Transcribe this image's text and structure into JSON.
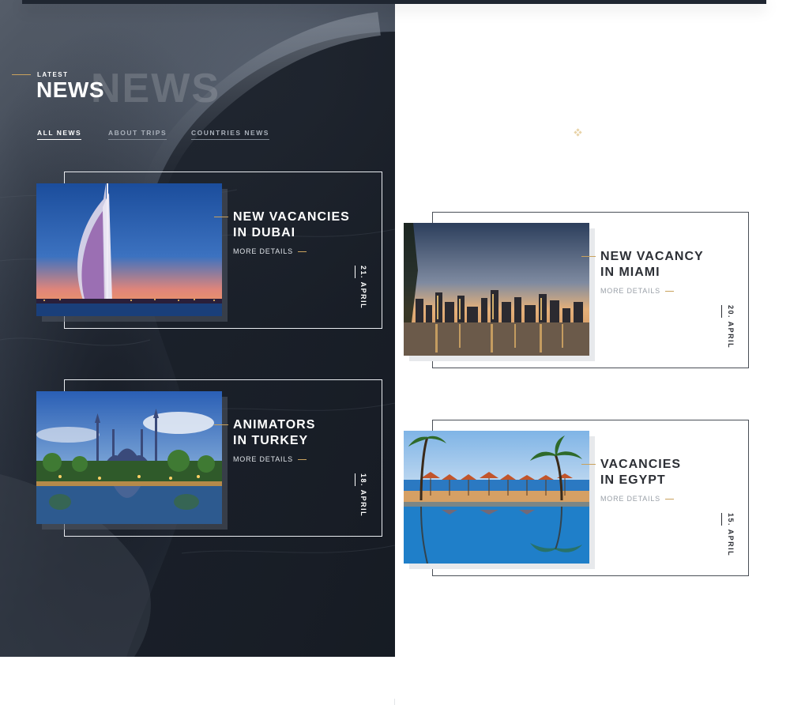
{
  "header": {
    "eyebrow": "LATEST",
    "title": "NEWS",
    "ghost_title": "NEWS"
  },
  "tabs": [
    {
      "label": "ALL NEWS",
      "active": true
    },
    {
      "label": "ABOUT TRIPS",
      "active": false
    },
    {
      "label": "COUNTRIES NEWS",
      "active": false
    }
  ],
  "cards": [
    {
      "line1": "NEW VACANCIES",
      "line2": "IN DUBAI",
      "more": "MORE DETAILS",
      "date": "21. APRIL",
      "image": "dubai-burj-al-arab"
    },
    {
      "line1": "NEW VACANCY",
      "line2": "IN MIAMI",
      "more": "MORE DETAILS",
      "date": "20. APRIL",
      "image": "miami-skyline"
    },
    {
      "line1": "ANIMATORS",
      "line2": "IN TURKEY",
      "more": "MORE DETAILS",
      "date": "18. APRIL",
      "image": "istanbul-blue-mosque"
    },
    {
      "line1": "VACANCIES",
      "line2": "IN EGYPT",
      "more": "MORE DETAILS",
      "date": "15. APRIL",
      "image": "egypt-beach-parasols"
    }
  ],
  "colors": {
    "accent": "#c9a25e",
    "dark_panel": "#2c333f",
    "text_dark": "#2c2f35"
  },
  "icons": [
    "diamond-dots-icon"
  ]
}
